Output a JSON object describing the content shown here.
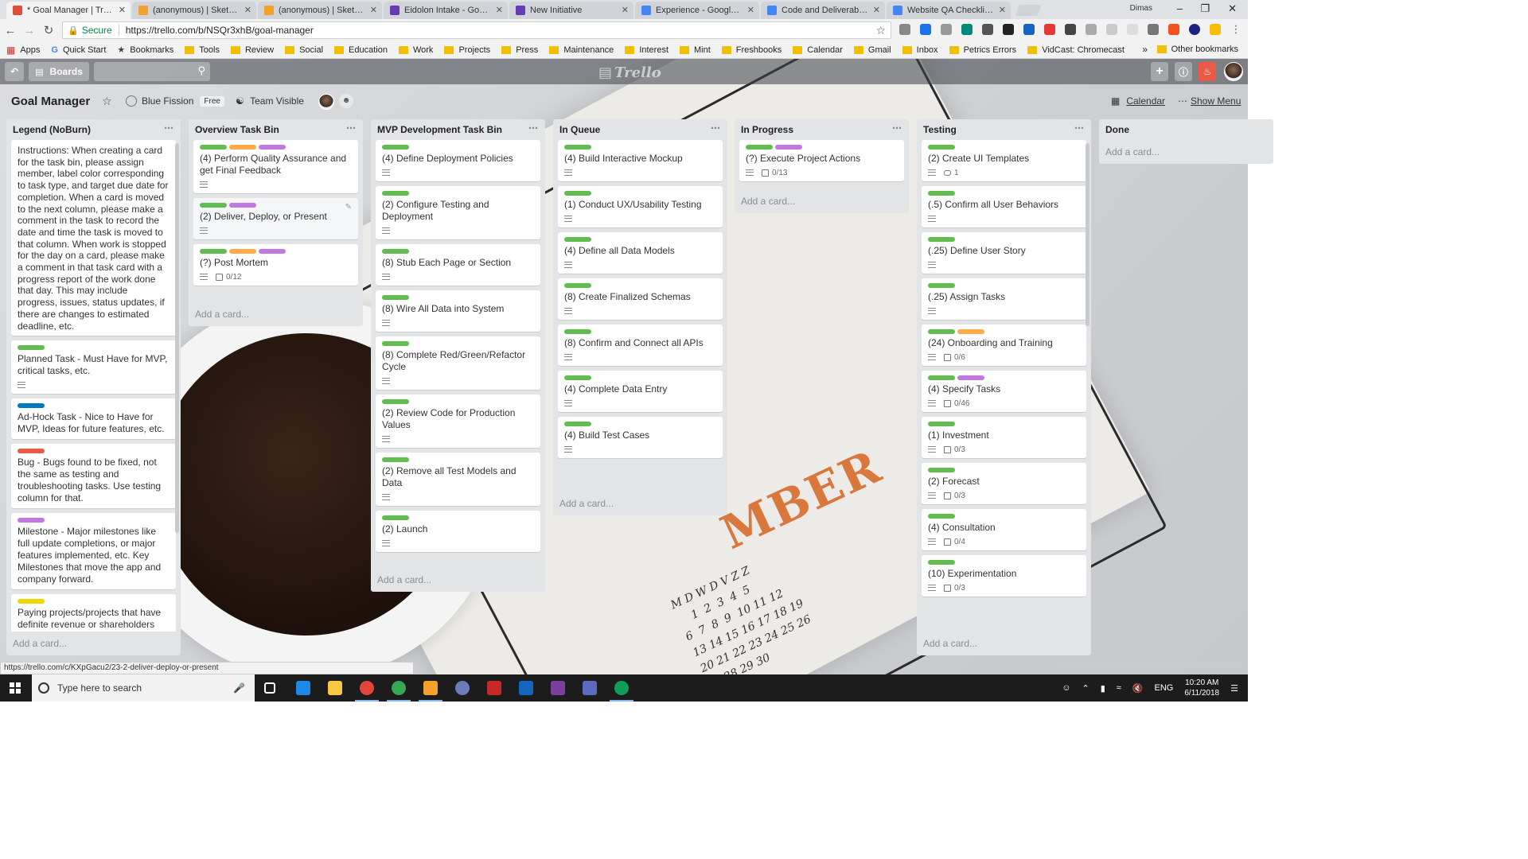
{
  "browser": {
    "tabs": [
      {
        "title": "* Goal Manager | Trello",
        "color": "#e04f3e",
        "active": true
      },
      {
        "title": "(anonymous) | Sketchboa",
        "color": "#f2a12c"
      },
      {
        "title": "(anonymous) | Sketchboa",
        "color": "#f2a12c"
      },
      {
        "title": "Eidolon Intake - Google F",
        "color": "#673ab7"
      },
      {
        "title": "New Initiative",
        "color": "#673ab7"
      },
      {
        "title": "Experience - Google Doc",
        "color": "#4285f4"
      },
      {
        "title": "Code and Deliverable Qu",
        "color": "#4285f4"
      },
      {
        "title": "Website QA Checklist - G",
        "color": "#4285f4"
      }
    ],
    "user": "Dimas",
    "secure_label": "Secure",
    "url": "https://trello.com/b/NSQr3xhB/goal-manager",
    "bookmarks": [
      "Apps",
      "Quick Start",
      "Bookmarks",
      "Tools",
      "Review",
      "Social",
      "Education",
      "Work",
      "Projects",
      "Press",
      "Maintenance",
      "Interest",
      "Mint",
      "Freshbooks",
      "Calendar",
      "Gmail",
      "Inbox",
      "Petrics Errors",
      "VidCast: Chromecast"
    ],
    "other_bookmarks": "Other bookmarks"
  },
  "trello": {
    "boards_label": "Boards",
    "logo": "Trello",
    "board_title": "Goal Manager",
    "team": "Blue Fission",
    "team_badge": "Free",
    "visibility": "Team Visible",
    "calendar": "Calendar",
    "show_menu": "Show Menu",
    "add_card": "Add a card...",
    "lists": [
      {
        "title": "Legend (NoBurn)",
        "legend_text": "Instructions: When creating a card for the task bin, please assign member, label color corresponding to task type, and target due date for completion. When a card is moved to the next column, please make a comment in the task to record the date and time the task is moved to that column. When work is stopped for the day on a card, please make a comment in that task card with a progress report of the work done that day. This may include progress, issues, status updates, if there are changes to estimated deadline, etc.",
        "cards": [
          {
            "labels": [
              "#61bd4f"
            ],
            "title": "Planned Task - Must Have for MVP, critical tasks, etc.",
            "desc": true
          },
          {
            "labels": [
              "#0079bf"
            ],
            "title": "Ad-Hock Task - Nice to Have for MVP, Ideas for future features, etc."
          },
          {
            "labels": [
              "#eb5a46"
            ],
            "title": "Bug - Bugs found to be fixed, not the same as testing and troubleshooting tasks. Use testing column for that."
          },
          {
            "labels": [
              "#c377e0"
            ],
            "title": "Milestone - Major milestones like full update completions, or major features implemented, etc. Key Milestones that move the app and company forward."
          },
          {
            "labels": [
              "#f2d600"
            ],
            "title": "Paying projects/projects that have definite revenue or shareholders"
          }
        ]
      },
      {
        "title": "Overview Task Bin",
        "cards": [
          {
            "labels": [
              "#61bd4f",
              "#ffab4a",
              "#c377e0"
            ],
            "title": "(4) Perform Quality Assurance and get Final Feedback",
            "desc": true
          },
          {
            "labels": [
              "#61bd4f",
              "#c377e0"
            ],
            "title": "(2) Deliver, Deploy, or Present",
            "desc": true,
            "hover": true
          },
          {
            "labels": [
              "#61bd4f",
              "#ffab4a",
              "#c377e0"
            ],
            "title": "(?) Post Mortem",
            "desc": true,
            "checklist": "0/12"
          }
        ]
      },
      {
        "title": "MVP Development Task Bin",
        "cards": [
          {
            "labels": [
              "#61bd4f"
            ],
            "title": "(4) Define Deployment Policies",
            "desc": true
          },
          {
            "labels": [
              "#61bd4f"
            ],
            "title": "(2) Configure Testing and Deployment",
            "desc": true
          },
          {
            "labels": [
              "#61bd4f"
            ],
            "title": "(8) Stub Each Page or Section",
            "desc": true
          },
          {
            "labels": [
              "#61bd4f"
            ],
            "title": "(8) Wire All Data into System",
            "desc": true
          },
          {
            "labels": [
              "#61bd4f"
            ],
            "title": "(8) Complete Red/Green/Refactor Cycle",
            "desc": true
          },
          {
            "labels": [
              "#61bd4f"
            ],
            "title": "(2) Review Code for Production Values",
            "desc": true
          },
          {
            "labels": [
              "#61bd4f"
            ],
            "title": "(2) Remove all Test Models and Data",
            "desc": true
          },
          {
            "labels": [
              "#61bd4f"
            ],
            "title": "(2) Launch",
            "desc": true
          }
        ]
      },
      {
        "title": "In Queue",
        "cards": [
          {
            "labels": [
              "#61bd4f"
            ],
            "title": "(4) Build Interactive Mockup",
            "desc": true
          },
          {
            "labels": [
              "#61bd4f"
            ],
            "title": "(1) Conduct UX/Usability Testing",
            "desc": true
          },
          {
            "labels": [
              "#61bd4f"
            ],
            "title": "(4) Define all Data Models",
            "desc": true
          },
          {
            "labels": [
              "#61bd4f"
            ],
            "title": "(8) Create Finalized Schemas",
            "desc": true
          },
          {
            "labels": [
              "#61bd4f"
            ],
            "title": "(8) Confirm and Connect all APIs",
            "desc": true
          },
          {
            "labels": [
              "#61bd4f"
            ],
            "title": "(4) Complete Data Entry",
            "desc": true
          },
          {
            "labels": [
              "#61bd4f"
            ],
            "title": "(4) Build Test Cases",
            "desc": true
          }
        ]
      },
      {
        "title": "In Progress",
        "cards": [
          {
            "labels": [
              "#61bd4f",
              "#c377e0"
            ],
            "title": "(?) Execute Project Actions",
            "desc": true,
            "checklist": "0/13"
          }
        ]
      },
      {
        "title": "Testing",
        "cards": [
          {
            "labels": [
              "#61bd4f"
            ],
            "title": "(2) Create UI Templates",
            "desc": true,
            "comments": "1"
          },
          {
            "labels": [
              "#61bd4f"
            ],
            "title": "(.5) Confirm all User Behaviors",
            "desc": true
          },
          {
            "labels": [
              "#61bd4f"
            ],
            "title": "(.25) Define User Story",
            "desc": true
          },
          {
            "labels": [
              "#61bd4f"
            ],
            "title": "(.25) Assign Tasks",
            "desc": true
          },
          {
            "labels": [
              "#61bd4f",
              "#ffab4a"
            ],
            "title": "(24) Onboarding and Training",
            "desc": true,
            "checklist": "0/6"
          },
          {
            "labels": [
              "#61bd4f",
              "#c377e0"
            ],
            "title": "(4) Specify Tasks",
            "desc": true,
            "checklist": "0/46"
          },
          {
            "labels": [
              "#61bd4f"
            ],
            "title": "(1) Investment",
            "desc": true,
            "checklist": "0/3"
          },
          {
            "labels": [
              "#61bd4f"
            ],
            "title": "(2) Forecast",
            "desc": true,
            "checklist": "0/3"
          },
          {
            "labels": [
              "#61bd4f"
            ],
            "title": "(4) Consultation",
            "desc": true,
            "checklist": "0/4"
          },
          {
            "labels": [
              "#61bd4f"
            ],
            "title": "(10) Experimentation",
            "desc": true,
            "checklist": "0/3"
          }
        ]
      },
      {
        "title": "Done",
        "cards": []
      }
    ]
  },
  "status_url": "https://trello.com/c/KXpGacu2/23-2-deliver-deploy-or-present",
  "taskbar": {
    "search_placeholder": "Type here to search",
    "lang": "ENG",
    "time": "10:20 AM",
    "date": "6/11/2018"
  }
}
